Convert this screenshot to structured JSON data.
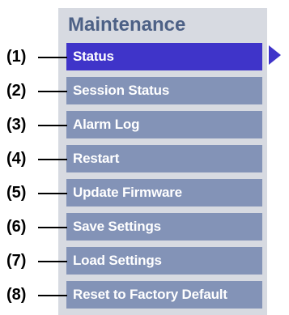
{
  "menu": {
    "heading": "Maintenance",
    "items": [
      {
        "label": "Status",
        "active": true
      },
      {
        "label": "Session Status",
        "active": false
      },
      {
        "label": "Alarm Log",
        "active": false
      },
      {
        "label": "Restart",
        "active": false
      },
      {
        "label": "Update Firmware",
        "active": false
      },
      {
        "label": "Save Settings",
        "active": false
      },
      {
        "label": "Load Settings",
        "active": false
      },
      {
        "label": "Reset to Factory Default",
        "active": false
      }
    ]
  },
  "callouts": [
    "(1)",
    "(2)",
    "(3)",
    "(4)",
    "(5)",
    "(6)",
    "(7)",
    "(8)"
  ],
  "icons": {
    "active_indicator": "triangle-right-icon"
  },
  "colors": {
    "active_item": "#3f34c9",
    "inactive_item": "#8393b7",
    "panel": "#d7dae1",
    "heading": "#4d6186"
  }
}
